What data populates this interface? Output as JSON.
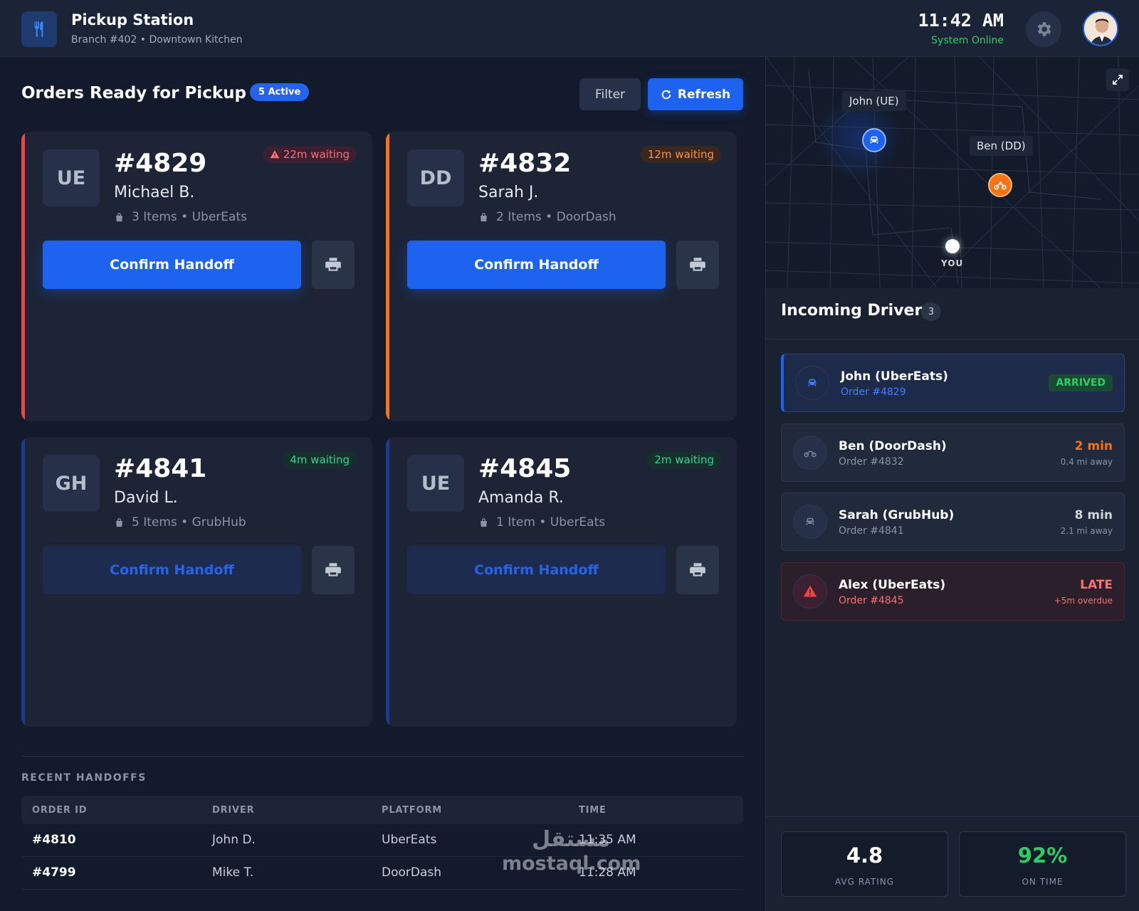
{
  "header": {
    "title": "Pickup Station",
    "subtitle": "Branch #402 • Downtown Kitchen",
    "time": "11:42 AM",
    "status": "System Online",
    "logo_icon": "utensils-icon",
    "settings_icon": "gear-icon"
  },
  "orders": {
    "title": "Orders Ready for Pickup",
    "active_badge": "5 Active",
    "filter_label": "Filter",
    "refresh_label": "Refresh",
    "cards": [
      {
        "initials": "UE",
        "number": "#4829",
        "customer": "Michael B.",
        "items": "3 Items • UberEats",
        "wait": "22m waiting",
        "confirm": "Confirm Handoff",
        "accent": "#ef4444",
        "wait_color": "#f87171",
        "wait_bg": "#3a2030"
      },
      {
        "initials": "DD",
        "number": "#4832",
        "customer": "Sarah J.",
        "items": "2 Items • DoorDash",
        "wait": "12m waiting",
        "confirm": "Confirm Handoff",
        "accent": "#f97316",
        "wait_color": "#fb923c",
        "wait_bg": "#3a2820"
      },
      {
        "initials": "GH",
        "number": "#4841",
        "customer": "David L.",
        "items": "5 Items • GrubHub",
        "wait": "4m waiting",
        "confirm": "Confirm Handoff",
        "accent": "#1e3a8a",
        "wait_color": "#34d399",
        "wait_bg": "#15302a"
      },
      {
        "initials": "UE",
        "number": "#4845",
        "customer": "Amanda R.",
        "items": "1 Item • UberEats",
        "wait": "2m waiting",
        "confirm": "Confirm Handoff",
        "accent": "#1e3a8a",
        "wait_color": "#34d399",
        "wait_bg": "#15302a"
      }
    ]
  },
  "recent": {
    "title": "RECENT HANDOFFS",
    "columns": [
      "ORDER ID",
      "DRIVER",
      "PLATFORM",
      "TIME"
    ],
    "rows": [
      [
        "#4810",
        "John D.",
        "UberEats",
        "11:35 AM"
      ],
      [
        "#4799",
        "Mike T.",
        "DoorDash",
        "11:28 AM"
      ]
    ]
  },
  "map": {
    "labels": {
      "john": "John (UE)",
      "ben": "Ben (DD)",
      "you": "YOU"
    }
  },
  "drivers": {
    "title": "Incoming Drivers",
    "count": "3",
    "list": [
      {
        "name": "John (UberEats)",
        "order": "Order #4829",
        "status": "ARRIVED",
        "detail": "",
        "icon": "car-icon"
      },
      {
        "name": "Ben (DoorDash)",
        "order": "Order #4832",
        "status": "2 min",
        "detail": "0.4 mi away",
        "icon": "motorcycle-icon"
      },
      {
        "name": "Sarah (GrubHub)",
        "order": "Order #4841",
        "status": "8 min",
        "detail": "2.1 mi away",
        "icon": "car-icon"
      },
      {
        "name": "Alex (UberEats)",
        "order": "Order #4845",
        "status": "LATE",
        "detail": "+5m overdue",
        "icon": "warning-icon"
      }
    ]
  },
  "stats": [
    {
      "value": "4.8",
      "label": "AVG RATING"
    },
    {
      "value": "92%",
      "label": "ON TIME"
    }
  ],
  "watermark": {
    "arabic": "مستقل",
    "latin": "mostaql.com"
  }
}
